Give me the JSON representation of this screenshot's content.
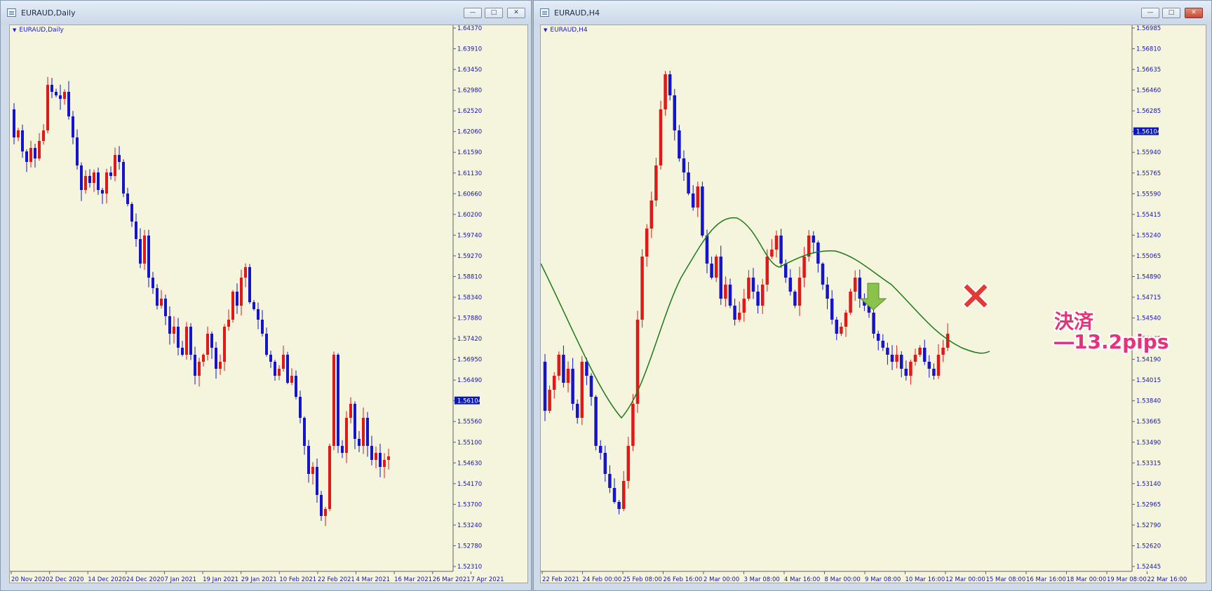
{
  "colors": {
    "bull": "#1414cc",
    "bear": "#e01818",
    "ma": "#1a7a1a",
    "axis_text": "#1414aa",
    "chart_bg": "#f5f4dc",
    "current_price_bg": "#0a18b8"
  },
  "left_window": {
    "title": "EURAUD,Daily",
    "symbol_label": "EURAUD,Daily",
    "price_labels": [
      "1.64370",
      "1.63910",
      "1.63450",
      "1.62980",
      "1.62520",
      "1.62060",
      "1.61590",
      "1.61130",
      "1.60660",
      "1.60200",
      "1.59740",
      "1.59270",
      "1.58810",
      "1.58340",
      "1.57880",
      "1.57420",
      "1.56950",
      "1.56490",
      "1.56104",
      "1.55560",
      "1.55100",
      "1.54630",
      "1.54170",
      "1.53700",
      "1.53240",
      "1.52780",
      "1.52310"
    ],
    "current_price": "1.56104",
    "time_labels": [
      "20 Nov 2020",
      "2 Dec 2020",
      "14 Dec 2020",
      "24 Dec 2020",
      "7 Jan 2021",
      "19 Jan 2021",
      "29 Jan 2021",
      "10 Feb 2021",
      "22 Feb 2021",
      "4 Mar 2021",
      "16 Mar 2021",
      "26 Mar 2021",
      "7 Apr 2021"
    ],
    "buttons": {
      "minimize": "—",
      "maximize": "□",
      "close": "✕"
    }
  },
  "right_window": {
    "title": "EURAUD,H4",
    "symbol_label": "EURAUD,H4",
    "price_labels": [
      "1.56985",
      "1.56810",
      "1.56635",
      "1.56460",
      "1.56285",
      "1.56104",
      "1.55940",
      "1.55765",
      "1.55590",
      "1.55415",
      "1.55240",
      "1.55065",
      "1.54890",
      "1.54715",
      "1.54540",
      "1.54365",
      "1.54190",
      "1.54015",
      "1.53840",
      "1.53665",
      "1.53490",
      "1.53315",
      "1.53140",
      "1.52965",
      "1.52790",
      "1.52620",
      "1.52445"
    ],
    "current_price": "1.56104",
    "time_labels": [
      "22 Feb 2021",
      "24 Feb 00:00",
      "25 Feb 08:00",
      "26 Feb 16:00",
      "2 Mar 00:00",
      "3 Mar 08:00",
      "4 Mar 16:00",
      "8 Mar 00:00",
      "9 Mar 08:00",
      "10 Mar 16:00",
      "12 Mar 00:00",
      "15 Mar 08:00",
      "16 Mar 16:00",
      "18 Mar 00:00",
      "19 Mar 08:00",
      "22 Mar 16:00"
    ],
    "annotation": {
      "line1": "決済",
      "line2": "―13.2pips"
    },
    "signal_icon": "down-arrow-icon",
    "exit_icon": "red-x-icon",
    "buttons": {
      "minimize": "—",
      "maximize": "□",
      "close": "✕"
    }
  }
}
